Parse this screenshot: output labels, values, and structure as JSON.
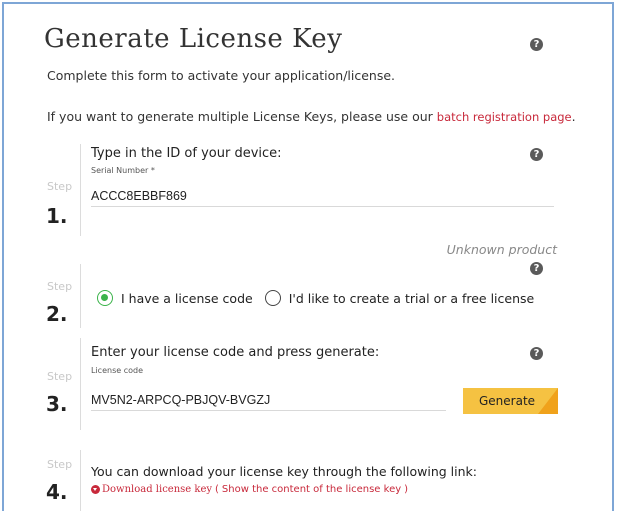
{
  "header": {
    "title": "Generate License Key",
    "help_icon": "question-circle-icon"
  },
  "intro": {
    "line1": "Complete this form to activate your application/license.",
    "line2_prefix": "If you want to generate multiple License Keys, please use our ",
    "line2_link": "batch registration page",
    "line2_suffix": "."
  },
  "steps": [
    {
      "label": "Step",
      "number": "1.",
      "question": "Type in the ID of your device:",
      "field_label": "Serial Number *",
      "field_value": "ACCC8EBBF869",
      "status": "Unknown product"
    },
    {
      "label": "Step",
      "number": "2.",
      "options": [
        {
          "label": "I have a license code",
          "checked": true
        },
        {
          "label": "I'd like to create a trial or a free license",
          "checked": false
        }
      ]
    },
    {
      "label": "Step",
      "number": "3.",
      "question": "Enter your license code and press generate:",
      "field_label": "License code",
      "field_value": "MV5N2-ARPCQ-PBJQV-BVGZJ",
      "button_label": "Generate"
    },
    {
      "label": "Step",
      "number": "4.",
      "text": "You can download your license key through the following link:",
      "download_link": "Download license key",
      "paren_open": "(",
      "show_link": "Show the content of the license key",
      "paren_close": ")"
    }
  ],
  "colors": {
    "accent_green": "#3bb34a",
    "link_red": "#c8293b",
    "button_yellow": "#f5c242",
    "frame_blue": "#7ea6d6"
  }
}
